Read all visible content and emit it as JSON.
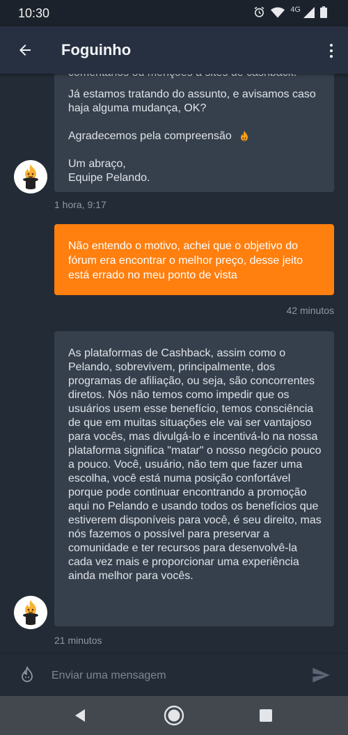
{
  "status_bar": {
    "time": "10:30",
    "network": "4G",
    "icons": [
      "alarm-icon",
      "wifi-icon",
      "signal-icon",
      "battery-icon"
    ]
  },
  "app_bar": {
    "title": "Foguinho",
    "back_icon": "arrow-left-icon",
    "menu_icon": "more-vert-icon"
  },
  "messages": [
    {
      "direction": "incoming",
      "truncated_first_line": "comentários ou menções a sites de cashback.",
      "paragraphs": [
        "Já estamos tratando do assunto, e avisamos caso haja alguma mudança, OK?",
        "Agradecemos pela compreensão",
        "Um abraço,\nEquipe Pelando."
      ],
      "emoji": "flame-emoji",
      "time": "1 hora, 9:17"
    },
    {
      "direction": "outgoing",
      "text": "Não entendo o motivo, achei que o objetivo do fórum era encontrar o melhor preço, desse jeito está errado no meu ponto de vista",
      "time": "42 minutos"
    },
    {
      "direction": "incoming",
      "text": "As plataformas de Cashback, assim como o Pelando, sobrevivem, principalmente, dos programas de afiliação, ou seja, são concorrentes diretos. Nós não temos como impedir que os usuários usem esse benefício, temos consciência de que em muitas situações ele vai ser vantajoso para vocês, mas divulgá-lo e incentivá-lo na nossa plataforma significa \"matar\" o nosso negócio pouco a pouco. Você, usuário, não tem que fazer uma escolha, você está numa posição confortável porque pode continuar encontrando a promoção aqui no Pelando e usando todos os benefícios que estiverem disponíveis para você, é seu direito, mas nós fazemos o possível para preservar a comunidade e ter recursos para desenvolvê-la cada vez mais e proporcionar uma experiência ainda melhor para vocês.",
      "time": "21 minutos"
    }
  ],
  "composer": {
    "placeholder": "Enviar uma mensagem",
    "value": "",
    "left_icon": "flame-outline-icon",
    "send_icon": "send-icon"
  },
  "nav_bar": {
    "icons": [
      "nav-back-icon",
      "nav-home-icon",
      "nav-recents-icon"
    ]
  },
  "colors": {
    "background": "#232b36",
    "app_bar": "#263040",
    "incoming_bubble": "#36404d",
    "outgoing_bubble": "#ff7f0f",
    "meta_text": "#8f99a6"
  }
}
